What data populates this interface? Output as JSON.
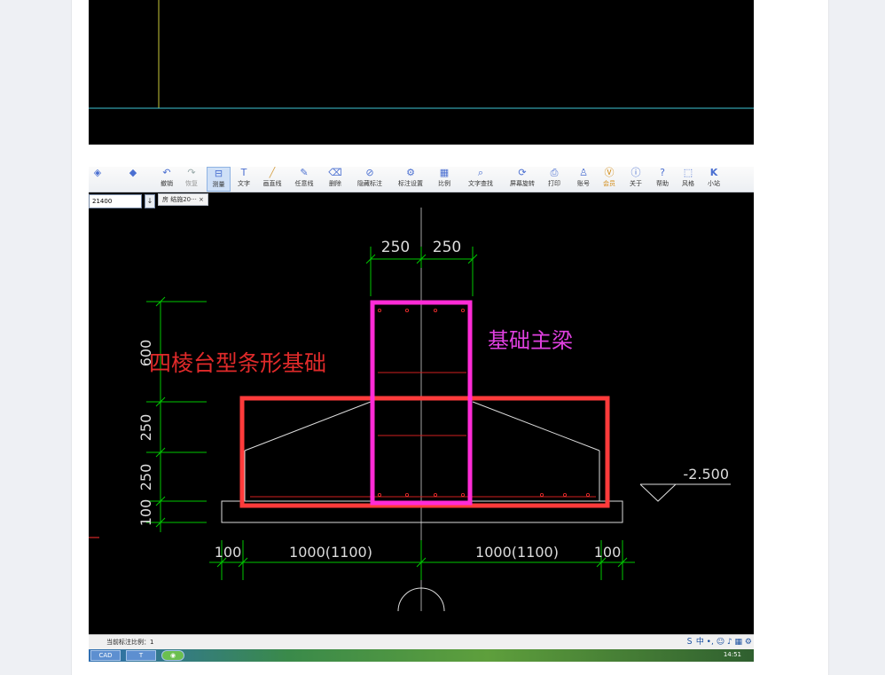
{
  "toolbar": {
    "items": [
      {
        "label": "撤销",
        "icon": "undo-icon"
      },
      {
        "label": "恢复",
        "icon": "redo-icon"
      },
      {
        "label": "测量",
        "icon": "measure-icon"
      },
      {
        "label": "文字",
        "icon": "text-icon"
      },
      {
        "label": "画直线",
        "icon": "line-icon"
      },
      {
        "label": "任意线",
        "icon": "freehand-icon"
      },
      {
        "label": "删除",
        "icon": "eraser-icon"
      },
      {
        "label": "隐藏标注",
        "icon": "hide-icon"
      },
      {
        "label": "标注设置",
        "icon": "annotation-settings-icon"
      },
      {
        "label": "比例",
        "icon": "ruler-icon"
      },
      {
        "label": "文字查找",
        "icon": "find-text-icon"
      },
      {
        "label": "屏幕旋转",
        "icon": "rotate-icon"
      },
      {
        "label": "打印",
        "icon": "print-icon"
      },
      {
        "label": "账号",
        "icon": "account-icon"
      },
      {
        "label": "会员",
        "icon": "vip-icon"
      },
      {
        "label": "关于",
        "icon": "info-icon"
      },
      {
        "label": "帮助",
        "icon": "help-icon"
      },
      {
        "label": "风格",
        "icon": "style-icon"
      },
      {
        "label": "小站",
        "icon": "k-icon"
      }
    ],
    "active_label": "测量",
    "scale_value": "21400",
    "tab_label": "房 结施20··· ×"
  },
  "drawing": {
    "title_left": "四棱台型条形基础",
    "title_right": "基础主梁",
    "dim_top_left": "250",
    "dim_top_right": "250",
    "dim_left_600": "600",
    "dim_left_250a": "250",
    "dim_left_250b": "250",
    "dim_left_100": "100",
    "dim_bottom_100_left": "100",
    "dim_bottom_width_left": "1000(1100)",
    "dim_bottom_width_right": "1000(1100)",
    "dim_bottom_100_right": "100",
    "elevation": "-2.500"
  },
  "status": {
    "scale_text": "当前标注比例：1",
    "clock": "14:51"
  },
  "colors": {
    "cad_bg": "#000000",
    "dim_green": "#00c800",
    "footing_red": "#ff3b3b",
    "beam_magenta": "#ff2bd6",
    "label_red": "#e02a2a",
    "label_magenta": "#e040e0"
  }
}
